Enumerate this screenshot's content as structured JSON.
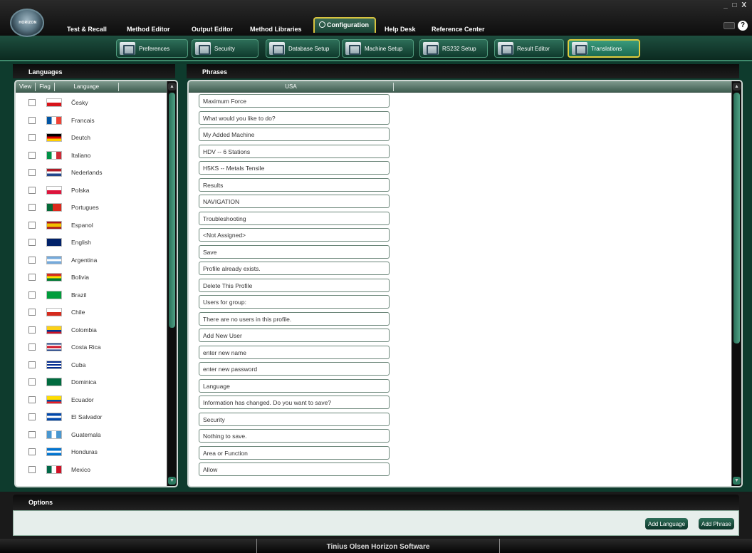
{
  "menu": {
    "logo_text": "HORIZON",
    "items": [
      "Test & Recall",
      "Method Editor",
      "Output Editor",
      "Method Libraries",
      "Configuration",
      "Help Desk",
      "Reference Center"
    ],
    "window_controls": "_ □ X"
  },
  "toolbar": {
    "items": [
      "Preferences",
      "Security",
      "Database Setup",
      "Machine Setup",
      "RS232 Setup",
      "Result Editor",
      "Translations"
    ]
  },
  "languages_panel": {
    "title": "Languages",
    "columns": [
      "View",
      "Flag",
      "Language"
    ],
    "rows": [
      {
        "label": "Česky",
        "flag": "cz"
      },
      {
        "label": "Francais",
        "flag": "fr"
      },
      {
        "label": "Deutch",
        "flag": "de"
      },
      {
        "label": "Italiano",
        "flag": "it"
      },
      {
        "label": "Nederlands",
        "flag": "nl"
      },
      {
        "label": "Polska",
        "flag": "pl"
      },
      {
        "label": "Portugues",
        "flag": "pt"
      },
      {
        "label": "Espanol",
        "flag": "es"
      },
      {
        "label": "English",
        "flag": "gb"
      },
      {
        "label": "Argentina",
        "flag": "ar"
      },
      {
        "label": "Bolivia",
        "flag": "bo"
      },
      {
        "label": "Brazil",
        "flag": "br"
      },
      {
        "label": "Chile",
        "flag": "cl"
      },
      {
        "label": "Colombia",
        "flag": "co"
      },
      {
        "label": "Costa Rica",
        "flag": "cr"
      },
      {
        "label": "Cuba",
        "flag": "cu"
      },
      {
        "label": "Dominica",
        "flag": "dm"
      },
      {
        "label": "Ecuador",
        "flag": "ec"
      },
      {
        "label": "El Salvador",
        "flag": "sv"
      },
      {
        "label": "Guatemala",
        "flag": "gt"
      },
      {
        "label": "Honduras",
        "flag": "hn"
      },
      {
        "label": "Mexico",
        "flag": "mx"
      }
    ]
  },
  "phrases_panel": {
    "title": "Phrases",
    "column": "USA",
    "rows": [
      "Maximum Force",
      "What would you like to do?",
      "My Added Machine",
      "HDV -- 6 Stations",
      "H5KS -- Metals Tensile",
      "Results",
      "NAVIGATION",
      "Troubleshooting",
      "<Not Assigned>",
      "Save",
      "Profile already exists.",
      "Delete This Profile",
      "Users for group:",
      "There are no users in this profile.",
      "Add New User",
      "enter new name",
      "enter new password",
      "Language",
      "Information has changed. Do you want to save?",
      "Security",
      "Nothing to save.",
      "Area or Function",
      "Allow"
    ]
  },
  "options": {
    "title": "Options",
    "add_language": "Add Language",
    "add_phrase": "Add Phrase"
  },
  "status": {
    "title": "Tinius Olsen Horizon Software"
  },
  "colors": {
    "accent_green": "#0e3b2d",
    "active_border": "#e0cd3e"
  }
}
